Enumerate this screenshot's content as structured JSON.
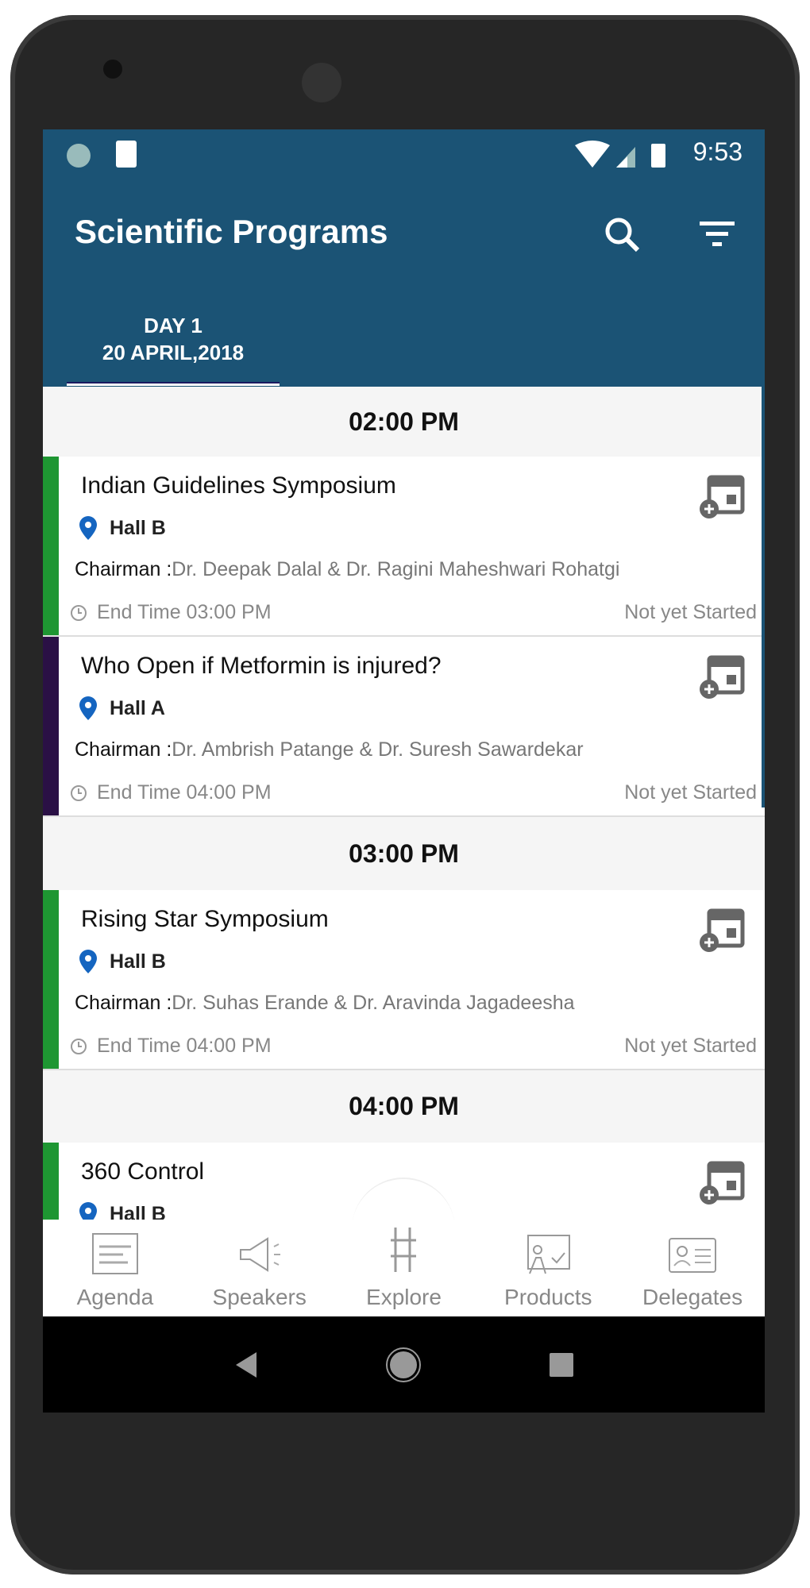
{
  "status_bar": {
    "time": "9:53"
  },
  "app_bar": {
    "title": "Scientific Programs",
    "search_icon": "search-icon",
    "filter_icon": "filter-icon"
  },
  "tabs": [
    {
      "day": "DAY 1",
      "date": "20 APRIL,2018"
    }
  ],
  "colors": {
    "primary": "#1b5375",
    "green": "#1e9632",
    "purple": "#2a1045",
    "pin": "#1565c0"
  },
  "sections": [
    {
      "time": "02:00 PM",
      "items": [
        {
          "title": "Indian Guidelines Symposium",
          "hall": "Hall B",
          "chairman_label": "Chairman :",
          "chairman": "Dr. Deepak Dalal & Dr. Ragini Maheshwari Rohatgi",
          "end": "End Time 03:00 PM",
          "status": "Not yet Started"
        },
        {
          "title": "Who Open if Metformin is injured?",
          "hall": "Hall A",
          "chairman_label": "Chairman :",
          "chairman": "Dr. Ambrish Patange & Dr. Suresh Sawardekar",
          "end": "End Time 04:00 PM",
          "status": "Not yet Started"
        }
      ]
    },
    {
      "time": "03:00 PM",
      "items": [
        {
          "title": "Rising Star Symposium",
          "hall": "Hall B",
          "chairman_label": "Chairman :",
          "chairman": "Dr. Suhas Erande & Dr. Aravinda Jagadeesha",
          "end": "End Time 04:00 PM",
          "status": "Not yet Started"
        }
      ]
    },
    {
      "time": "04:00 PM",
      "items": [
        {
          "title": "360 Control",
          "hall": "Hall B"
        }
      ]
    }
  ],
  "bottom_nav": [
    {
      "label": "Agenda"
    },
    {
      "label": "Speakers"
    },
    {
      "label": "Explore"
    },
    {
      "label": "Products"
    },
    {
      "label": "Delegates"
    }
  ]
}
